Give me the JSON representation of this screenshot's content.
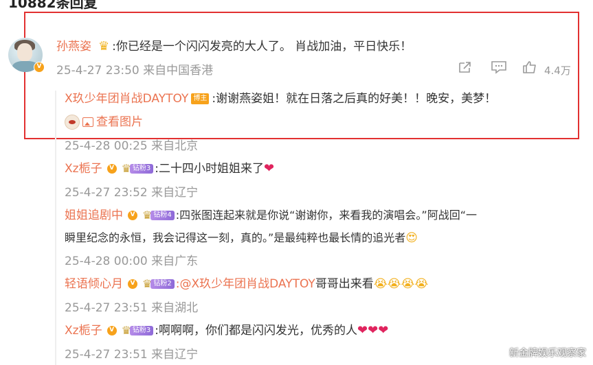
{
  "page_title": "10882条回复",
  "main_comment": {
    "name": "孙燕姿",
    "text": ":你已经是一个闪闪发亮的大人了。 肖战加油，平日快乐！",
    "time": "25-4-27 23:50 来自中国香港",
    "like_count": "4.4万"
  },
  "host_reply": {
    "name": "X玖少年团肖战DAYTOY",
    "badge": "博主",
    "text": ":谢谢燕姿姐！就在日落之后真的好美！！晚安，美梦！",
    "view_image": "查看图片",
    "time": "25-4-28 00:25 来自北京"
  },
  "replies": [
    {
      "name": "Xz栀子",
      "fan_level": "钻粉3",
      "text": ":二十四小时姐姐来了",
      "time": "25-4-27 23:52 来自辽宁"
    },
    {
      "name": "姐姐追剧中",
      "fan_level": "钻粉4",
      "text_line1": ":四张图连起来就是你说“谢谢你，来看我的演唱会。”阿战回“一",
      "text_line2": "瞬里纪念的永恒，我会记得这一刻，真的。”是最纯粹也最长情的追光者",
      "time": "25-4-28 00:00 来自广东"
    },
    {
      "name": "轻语倾心月",
      "fan_level": "钻粉2",
      "mention": ":@X玖少年团肖战DAYTOY",
      "text": " 哥哥出来看",
      "time": "25-4-27 23:51 来自湖北"
    },
    {
      "name": "Xz栀子",
      "fan_level": "钻粉3",
      "text": ":啊啊啊，你们都是闪闪发光，优秀的人",
      "time": "25-4-27 23:51 来自辽宁"
    }
  ],
  "watermark": "新金牌娱乐观察家",
  "icons": {
    "share": "share-icon",
    "comment": "comment-icon",
    "like": "like-icon",
    "verified": "verified-icon",
    "crown": "crown-icon",
    "heart": "heart-icon",
    "image": "image-icon"
  },
  "colors": {
    "username": "#eb7350",
    "meta": "#999999",
    "highlight_box": "#e23030",
    "verified": "#f7a21b",
    "fan_badge": "#8e6ad8",
    "heart": "#e0245e"
  }
}
